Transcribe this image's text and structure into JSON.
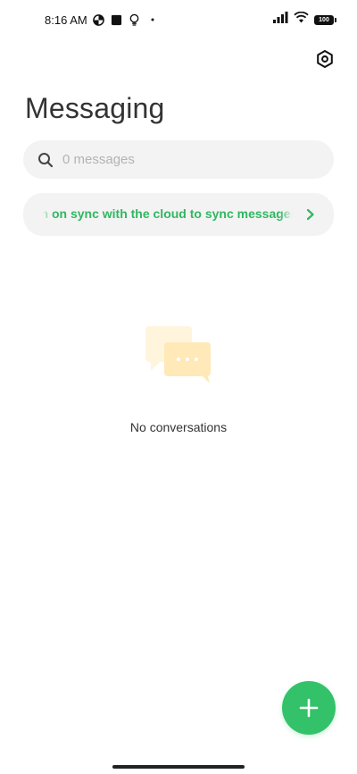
{
  "status_bar": {
    "time": "8:16 AM",
    "battery_level": "100",
    "icons": [
      "data-saver-icon",
      "square-notification-icon",
      "lightbulb-icon",
      "dot-icon",
      "signal-icon",
      "wifi-icon",
      "battery-icon"
    ]
  },
  "header": {
    "title": "Messaging",
    "settings_icon": "settings-hexagon-icon"
  },
  "search": {
    "placeholder": "0 messages",
    "value": ""
  },
  "sync_banner": {
    "text": "Turn on sync with the cloud to sync messages"
  },
  "empty_state": {
    "message": "No conversations",
    "illustration": "chat-bubbles-icon"
  },
  "fab": {
    "icon": "plus-icon"
  },
  "colors": {
    "accent": "#33c26a",
    "sync_text": "#2fb761",
    "surface": "#f3f3f3",
    "illustration_light": "#fff5dc",
    "illustration_main": "#ffe9b8"
  }
}
